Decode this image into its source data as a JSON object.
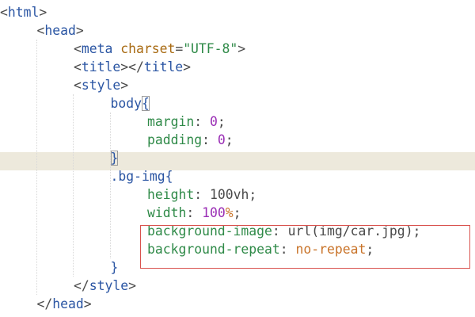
{
  "editor": {
    "language": "html",
    "lines": [
      {
        "indent": 0,
        "tokens": [
          {
            "t": "<",
            "c": "punct"
          },
          {
            "t": "html",
            "c": "tag"
          },
          {
            "t": ">",
            "c": "punct"
          }
        ]
      },
      {
        "indent": 1,
        "tokens": [
          {
            "t": "<",
            "c": "punct"
          },
          {
            "t": "head",
            "c": "tag"
          },
          {
            "t": ">",
            "c": "punct"
          }
        ]
      },
      {
        "indent": 2,
        "tokens": [
          {
            "t": "<",
            "c": "punct"
          },
          {
            "t": "meta",
            "c": "tag"
          },
          {
            "t": " ",
            "c": "punct"
          },
          {
            "t": "charset",
            "c": "attr"
          },
          {
            "t": "=",
            "c": "punct"
          },
          {
            "t": "\"UTF-8\"",
            "c": "str"
          },
          {
            "t": ">",
            "c": "punct"
          }
        ]
      },
      {
        "indent": 2,
        "tokens": [
          {
            "t": "<",
            "c": "punct"
          },
          {
            "t": "title",
            "c": "tag"
          },
          {
            "t": "></",
            "c": "punct"
          },
          {
            "t": "title",
            "c": "tag"
          },
          {
            "t": ">",
            "c": "punct"
          }
        ]
      },
      {
        "indent": 2,
        "tokens": [
          {
            "t": "<",
            "c": "punct"
          },
          {
            "t": "style",
            "c": "tag"
          },
          {
            "t": ">",
            "c": "punct"
          }
        ]
      },
      {
        "indent": 3,
        "tokens": [
          {
            "t": "body",
            "c": "sel"
          },
          {
            "t": "{",
            "c": "sel",
            "match": true
          }
        ]
      },
      {
        "indent": 4,
        "tokens": [
          {
            "t": "margin",
            "c": "prop"
          },
          {
            "t": ": ",
            "c": "punct"
          },
          {
            "t": "0",
            "c": "num"
          },
          {
            "t": ";",
            "c": "punct"
          }
        ]
      },
      {
        "indent": 4,
        "tokens": [
          {
            "t": "padding",
            "c": "prop"
          },
          {
            "t": ": ",
            "c": "punct"
          },
          {
            "t": "0",
            "c": "num"
          },
          {
            "t": ";",
            "c": "punct"
          }
        ]
      },
      {
        "indent": 3,
        "tokens": [
          {
            "t": "}",
            "c": "sel",
            "match": true
          }
        ]
      },
      {
        "indent": 3,
        "tokens": [
          {
            "t": ".bg-img{",
            "c": "sel"
          }
        ]
      },
      {
        "indent": 4,
        "tokens": [
          {
            "t": "height",
            "c": "prop"
          },
          {
            "t": ": ",
            "c": "punct"
          },
          {
            "t": "100vh",
            "c": "punct"
          },
          {
            "t": ";",
            "c": "punct"
          }
        ]
      },
      {
        "indent": 4,
        "tokens": [
          {
            "t": "width",
            "c": "prop"
          },
          {
            "t": ": ",
            "c": "punct"
          },
          {
            "t": "100",
            "c": "num"
          },
          {
            "t": "%",
            "c": "val"
          },
          {
            "t": ";",
            "c": "punct"
          }
        ]
      },
      {
        "indent": 4,
        "tokens": [
          {
            "t": "background-image",
            "c": "prop"
          },
          {
            "t": ": ",
            "c": "punct"
          },
          {
            "t": "url",
            "c": "punct"
          },
          {
            "t": "(",
            "c": "punct"
          },
          {
            "t": "img/car.jpg",
            "c": "punct"
          },
          {
            "t": ");",
            "c": "punct"
          }
        ]
      },
      {
        "indent": 4,
        "tokens": [
          {
            "t": "background-repeat",
            "c": "prop"
          },
          {
            "t": ": ",
            "c": "punct"
          },
          {
            "t": "no-repeat",
            "c": "val"
          },
          {
            "t": ";",
            "c": "punct"
          }
        ]
      },
      {
        "indent": 3,
        "tokens": [
          {
            "t": "}",
            "c": "sel"
          }
        ]
      },
      {
        "indent": 2,
        "tokens": [
          {
            "t": "</",
            "c": "punct"
          },
          {
            "t": "style",
            "c": "tag"
          },
          {
            "t": ">",
            "c": "punct"
          }
        ]
      },
      {
        "indent": 1,
        "tokens": [
          {
            "t": "</",
            "c": "punct"
          },
          {
            "t": "head",
            "c": "tag"
          },
          {
            "t": ">",
            "c": "punct"
          }
        ]
      }
    ],
    "current_line": 9,
    "highlighted_lines": [
      13,
      14
    ],
    "colors": {
      "background": "#ffffff",
      "current_line": "#ede9dc",
      "tag": "#2a55a3",
      "attribute": "#a86a12",
      "string": "#2f8a48",
      "property": "#2f8a48",
      "number": "#9a2eb5",
      "value": "#c9742a",
      "annotation_box": "#d9534f"
    }
  }
}
